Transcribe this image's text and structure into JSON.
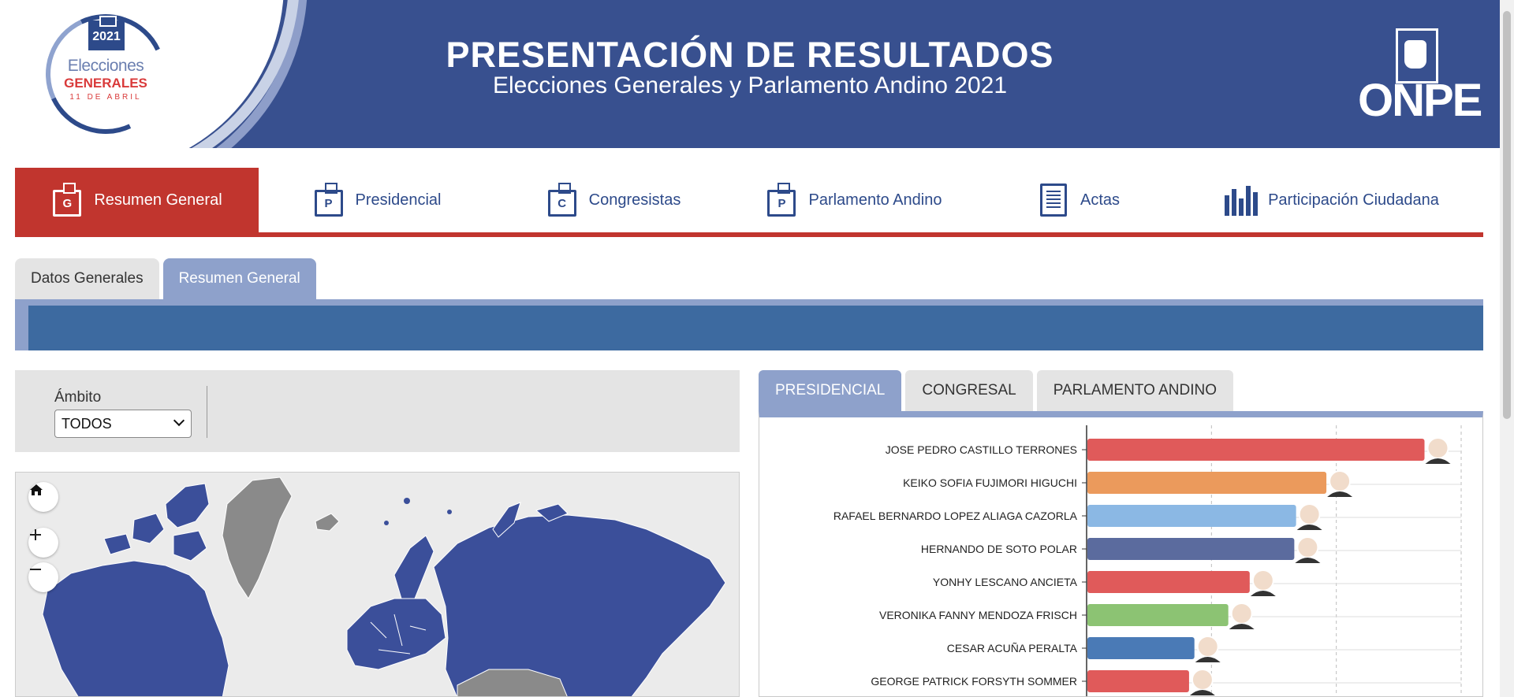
{
  "header": {
    "title": "PRESENTACIÓN DE RESULTADOS",
    "subtitle": "Elecciones Generales y Parlamento Andino 2021",
    "logo": {
      "year": "2021",
      "line1": "Elecciones",
      "line2": "GENERALES",
      "line3": "11 DE ABRIL"
    },
    "org_logo": "ONPE"
  },
  "main_nav": [
    {
      "label": "Resumen General",
      "icon": "G",
      "active": true
    },
    {
      "label": "Presidencial",
      "icon": "P",
      "active": false
    },
    {
      "label": "Congresistas",
      "icon": "C",
      "active": false
    },
    {
      "label": "Parlamento Andino",
      "icon": "P",
      "active": false
    },
    {
      "label": "Actas",
      "icon": "document",
      "active": false
    },
    {
      "label": "Participación Ciudadana",
      "icon": "bar-chart",
      "active": false
    }
  ],
  "sub_tabs": [
    {
      "label": "Datos Generales",
      "active": false
    },
    {
      "label": "Resumen General",
      "active": true
    }
  ],
  "filter": {
    "label": "Ámbito",
    "selected": "TODOS"
  },
  "result_tabs": [
    {
      "label": "PRESIDENCIAL",
      "active": true
    },
    {
      "label": "CONGRESAL",
      "active": false
    },
    {
      "label": "PARLAMENTO ANDINO",
      "active": false
    }
  ],
  "colors": {
    "header": "#38508f",
    "accent_red": "#c1352e",
    "tab_active": "#8ea1cb",
    "land": "#3b4f9a",
    "land_other": "#8a8a8a"
  },
  "chart_data": {
    "type": "bar",
    "orientation": "horizontal",
    "categories": [
      "JOSE PEDRO CASTILLO TERRONES",
      "KEIKO SOFIA FUJIMORI HIGUCHI",
      "RAFAEL BERNARDO LOPEZ ALIAGA CAZORLA",
      "HERNANDO DE SOTO POLAR",
      "YONHY LESCANO ANCIETA",
      "VERONIKA FANNY MENDOZA FRISCH",
      "CESAR ACUÑA PERALTA",
      "GEORGE PATRICK FORSYTH SOMMER"
    ],
    "values": [
      18.9,
      13.4,
      11.7,
      11.6,
      9.1,
      7.9,
      6.0,
      5.7
    ],
    "colors": [
      "#e05a5a",
      "#eb9a5c",
      "#8bb8e4",
      "#5b6b9e",
      "#e05a5a",
      "#8cc373",
      "#4a7ab6",
      "#e05a5a"
    ],
    "xlim": [
      0,
      21
    ],
    "grid": true
  }
}
